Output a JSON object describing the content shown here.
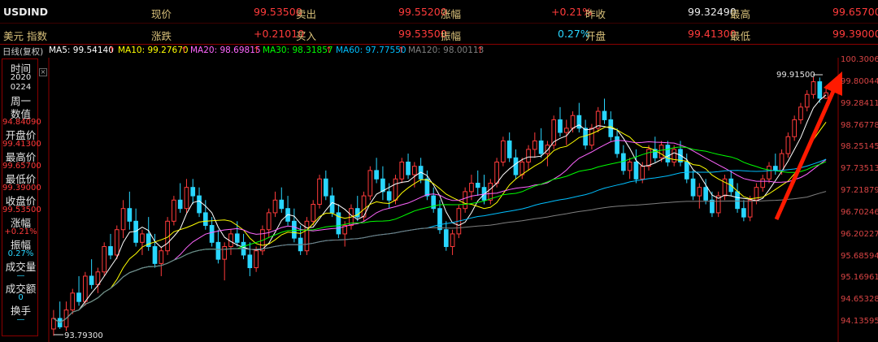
{
  "header": {
    "row1": {
      "symbol": "USDIND",
      "price_label": "现价",
      "price": "99.53500",
      "ask_label": "卖出",
      "ask": "99.55200",
      "change_pct_label": "涨幅",
      "change_pct": "+0.21%",
      "prev_close_label": "昨收",
      "prev_close": "99.32490",
      "high_label": "最高",
      "high": "99.65700"
    },
    "row2": {
      "name": "美元 指数",
      "change_label": "涨跌",
      "change": "+0.21010",
      "bid_label": "买入",
      "bid": "99.53500",
      "amplitude_label": "振幅",
      "amplitude": "0.27%",
      "open_label": "开盘",
      "open": "99.41300",
      "low_label": "最低",
      "low": "99.39000"
    }
  },
  "ma_bar": {
    "period": "日线(复权)",
    "ma5": "MA5: 99.54140",
    "ma10": "MA10: 99.27670",
    "ma20": "MA20: 98.69815",
    "ma30": "MA30: 98.31857",
    "ma60": "MA60: 97.77550",
    "ma120": "MA120: 98.00113",
    "arrow": "↑"
  },
  "info_panel": {
    "time_label": "时间",
    "year": "2020",
    "date": "0224",
    "weekday": "周一",
    "value_label": "数值",
    "value": "94.84090",
    "open_label": "开盘价",
    "open": "99.41300",
    "high_label": "最高价",
    "high": "99.65700",
    "low_label": "最低价",
    "low": "99.39000",
    "close_label": "收盘价",
    "close": "99.53500",
    "change_label": "涨幅",
    "change": "+0.21%",
    "amp_label": "振幅",
    "amp": "0.27%",
    "volume_label": "成交量",
    "volume": "—",
    "amount_label": "成交额",
    "amount": "0",
    "turnover_label": "换手",
    "turnover": "—"
  },
  "price_axis": {
    "ticks": [
      "100.3006",
      "99.80044",
      "99.28411",
      "98.76778",
      "98.25145",
      "97.73513",
      "97.21879",
      "96.70246",
      "96.20227",
      "95.68594",
      "95.16961",
      "94.65328",
      "94.13595"
    ]
  },
  "annotations": {
    "high_label": "99.91500",
    "low_label": "93.79300"
  },
  "colors": {
    "up": "#ff3b3b",
    "down": "#29d6ff",
    "ma5": "#ffffff",
    "ma10": "#ffff00",
    "ma20": "#ff66ff",
    "ma30": "#00ff00",
    "ma60": "#00bfff",
    "ma120": "#7f7f7f",
    "arrow": "#ff1a00"
  },
  "chart_data": {
    "type": "candlestick",
    "y_range": [
      93.7,
      100.35
    ],
    "candles": [
      [
        93.95,
        94.4,
        93.79,
        94.2
      ],
      [
        94.2,
        94.6,
        93.95,
        94.0
      ],
      [
        94.0,
        94.6,
        93.9,
        94.4
      ],
      [
        94.4,
        94.9,
        94.3,
        94.8
      ],
      [
        94.8,
        95.2,
        94.5,
        94.6
      ],
      [
        94.6,
        95.3,
        94.5,
        95.2
      ],
      [
        95.2,
        95.6,
        94.9,
        95.0
      ],
      [
        95.0,
        95.4,
        94.8,
        95.3
      ],
      [
        95.3,
        96.0,
        95.2,
        95.9
      ],
      [
        95.9,
        96.2,
        95.6,
        95.7
      ],
      [
        95.7,
        96.4,
        95.6,
        96.3
      ],
      [
        96.3,
        97.0,
        96.1,
        96.8
      ],
      [
        96.8,
        97.2,
        96.3,
        96.5
      ],
      [
        96.5,
        96.8,
        95.9,
        96.0
      ],
      [
        96.0,
        96.3,
        95.7,
        96.2
      ],
      [
        96.2,
        96.6,
        95.8,
        95.9
      ],
      [
        95.9,
        96.2,
        95.4,
        95.5
      ],
      [
        95.5,
        95.9,
        95.2,
        95.8
      ],
      [
        95.8,
        96.6,
        95.7,
        96.5
      ],
      [
        96.5,
        97.1,
        96.4,
        97.0
      ],
      [
        97.0,
        97.4,
        96.7,
        96.8
      ],
      [
        96.8,
        97.5,
        96.7,
        97.3
      ],
      [
        97.3,
        97.5,
        96.9,
        97.1
      ],
      [
        97.1,
        97.3,
        96.6,
        96.7
      ],
      [
        96.7,
        97.0,
        96.3,
        96.4
      ],
      [
        96.4,
        96.6,
        95.9,
        96.0
      ],
      [
        96.0,
        96.3,
        95.5,
        95.6
      ],
      [
        95.6,
        96.0,
        95.1,
        95.9
      ],
      [
        95.9,
        96.3,
        95.7,
        96.2
      ],
      [
        96.2,
        96.5,
        95.9,
        96.0
      ],
      [
        96.0,
        96.2,
        95.6,
        95.7
      ],
      [
        95.7,
        96.0,
        95.2,
        95.4
      ],
      [
        95.4,
        95.9,
        95.3,
        95.8
      ],
      [
        95.8,
        96.4,
        95.7,
        96.3
      ],
      [
        96.3,
        96.8,
        96.1,
        96.7
      ],
      [
        96.7,
        97.2,
        96.6,
        97.0
      ],
      [
        97.0,
        97.3,
        96.7,
        96.8
      ],
      [
        96.8,
        97.1,
        96.4,
        96.5
      ],
      [
        96.5,
        96.8,
        96.0,
        96.1
      ],
      [
        96.1,
        96.4,
        95.7,
        95.8
      ],
      [
        95.8,
        96.6,
        95.7,
        96.5
      ],
      [
        96.5,
        97.0,
        96.4,
        96.9
      ],
      [
        96.9,
        97.6,
        96.8,
        97.5
      ],
      [
        97.5,
        97.7,
        97.0,
        97.1
      ],
      [
        97.1,
        97.3,
        96.6,
        96.7
      ],
      [
        96.7,
        96.9,
        96.1,
        96.2
      ],
      [
        96.2,
        96.5,
        95.9,
        96.4
      ],
      [
        96.4,
        96.9,
        96.3,
        96.8
      ],
      [
        96.8,
        97.1,
        96.5,
        96.6
      ],
      [
        96.6,
        97.2,
        96.5,
        97.1
      ],
      [
        97.1,
        97.8,
        97.0,
        97.7
      ],
      [
        97.7,
        98.0,
        97.4,
        97.5
      ],
      [
        97.5,
        97.8,
        97.0,
        97.2
      ],
      [
        97.2,
        97.4,
        96.8,
        97.0
      ],
      [
        97.0,
        97.6,
        96.9,
        97.5
      ],
      [
        97.5,
        98.0,
        97.4,
        97.9
      ],
      [
        97.9,
        98.1,
        97.5,
        97.6
      ],
      [
        97.6,
        97.9,
        97.3,
        97.8
      ],
      [
        97.8,
        98.0,
        97.4,
        97.5
      ],
      [
        97.5,
        97.7,
        97.0,
        97.1
      ],
      [
        97.1,
        97.3,
        96.7,
        96.8
      ],
      [
        96.8,
        97.0,
        96.2,
        96.3
      ],
      [
        96.3,
        96.5,
        95.8,
        95.9
      ],
      [
        95.9,
        96.3,
        95.7,
        96.2
      ],
      [
        96.2,
        96.9,
        96.1,
        96.8
      ],
      [
        96.8,
        97.3,
        96.7,
        97.2
      ],
      [
        97.2,
        97.6,
        97.0,
        97.4
      ],
      [
        97.4,
        97.7,
        97.1,
        97.3
      ],
      [
        97.3,
        97.6,
        96.9,
        97.0
      ],
      [
        97.0,
        97.5,
        96.9,
        97.4
      ],
      [
        97.4,
        98.0,
        97.3,
        97.9
      ],
      [
        97.9,
        98.5,
        97.8,
        98.4
      ],
      [
        98.4,
        98.6,
        97.9,
        98.0
      ],
      [
        98.0,
        98.2,
        97.5,
        97.6
      ],
      [
        97.6,
        98.0,
        97.5,
        97.9
      ],
      [
        97.9,
        98.3,
        97.7,
        98.2
      ],
      [
        98.2,
        98.6,
        98.0,
        98.4
      ],
      [
        98.4,
        98.7,
        98.0,
        98.1
      ],
      [
        98.1,
        98.4,
        97.8,
        98.3
      ],
      [
        98.3,
        99.0,
        98.2,
        98.9
      ],
      [
        98.9,
        99.2,
        98.5,
        98.6
      ],
      [
        98.6,
        98.9,
        98.3,
        98.7
      ],
      [
        98.7,
        99.1,
        98.6,
        99.0
      ],
      [
        99.0,
        99.3,
        98.6,
        98.7
      ],
      [
        98.7,
        98.9,
        98.2,
        98.3
      ],
      [
        98.3,
        98.8,
        98.2,
        98.7
      ],
      [
        98.7,
        99.2,
        98.6,
        99.1
      ],
      [
        99.1,
        99.4,
        98.8,
        98.9
      ],
      [
        98.9,
        99.1,
        98.4,
        98.5
      ],
      [
        98.5,
        98.7,
        98.0,
        98.1
      ],
      [
        98.1,
        98.3,
        97.6,
        97.7
      ],
      [
        97.7,
        98.0,
        97.5,
        97.9
      ],
      [
        97.9,
        98.2,
        97.4,
        97.5
      ],
      [
        97.5,
        97.9,
        97.4,
        97.8
      ],
      [
        97.8,
        98.3,
        97.7,
        98.2
      ],
      [
        98.2,
        98.5,
        97.9,
        98.0
      ],
      [
        98.0,
        98.4,
        97.9,
        98.3
      ],
      [
        98.3,
        98.4,
        97.8,
        97.9
      ],
      [
        97.9,
        98.3,
        97.8,
        98.2
      ],
      [
        98.2,
        98.4,
        97.8,
        97.9
      ],
      [
        97.9,
        98.1,
        97.4,
        97.5
      ],
      [
        97.5,
        97.7,
        97.0,
        97.1
      ],
      [
        97.1,
        97.4,
        96.8,
        97.3
      ],
      [
        97.3,
        97.5,
        96.9,
        97.0
      ],
      [
        97.0,
        97.2,
        96.6,
        96.7
      ],
      [
        96.7,
        97.2,
        96.6,
        97.1
      ],
      [
        97.1,
        97.6,
        97.0,
        97.5
      ],
      [
        97.5,
        97.7,
        97.1,
        97.2
      ],
      [
        97.2,
        97.4,
        96.7,
        96.8
      ],
      [
        96.8,
        97.0,
        96.5,
        96.6
      ],
      [
        96.6,
        97.1,
        96.5,
        97.0
      ],
      [
        97.0,
        97.4,
        96.9,
        97.3
      ],
      [
        97.3,
        97.6,
        97.2,
        97.5
      ],
      [
        97.5,
        97.9,
        97.4,
        97.8
      ],
      [
        97.8,
        98.1,
        97.6,
        97.7
      ],
      [
        97.7,
        98.2,
        97.6,
        98.1
      ],
      [
        98.1,
        98.6,
        98.0,
        98.5
      ],
      [
        98.5,
        99.0,
        98.4,
        98.9
      ],
      [
        98.9,
        99.3,
        98.8,
        99.2
      ],
      [
        99.2,
        99.6,
        99.1,
        99.5
      ],
      [
        99.5,
        99.91,
        99.4,
        99.8
      ],
      [
        99.8,
        99.9,
        99.3,
        99.41
      ],
      [
        99.41,
        99.66,
        99.39,
        99.54
      ]
    ]
  }
}
